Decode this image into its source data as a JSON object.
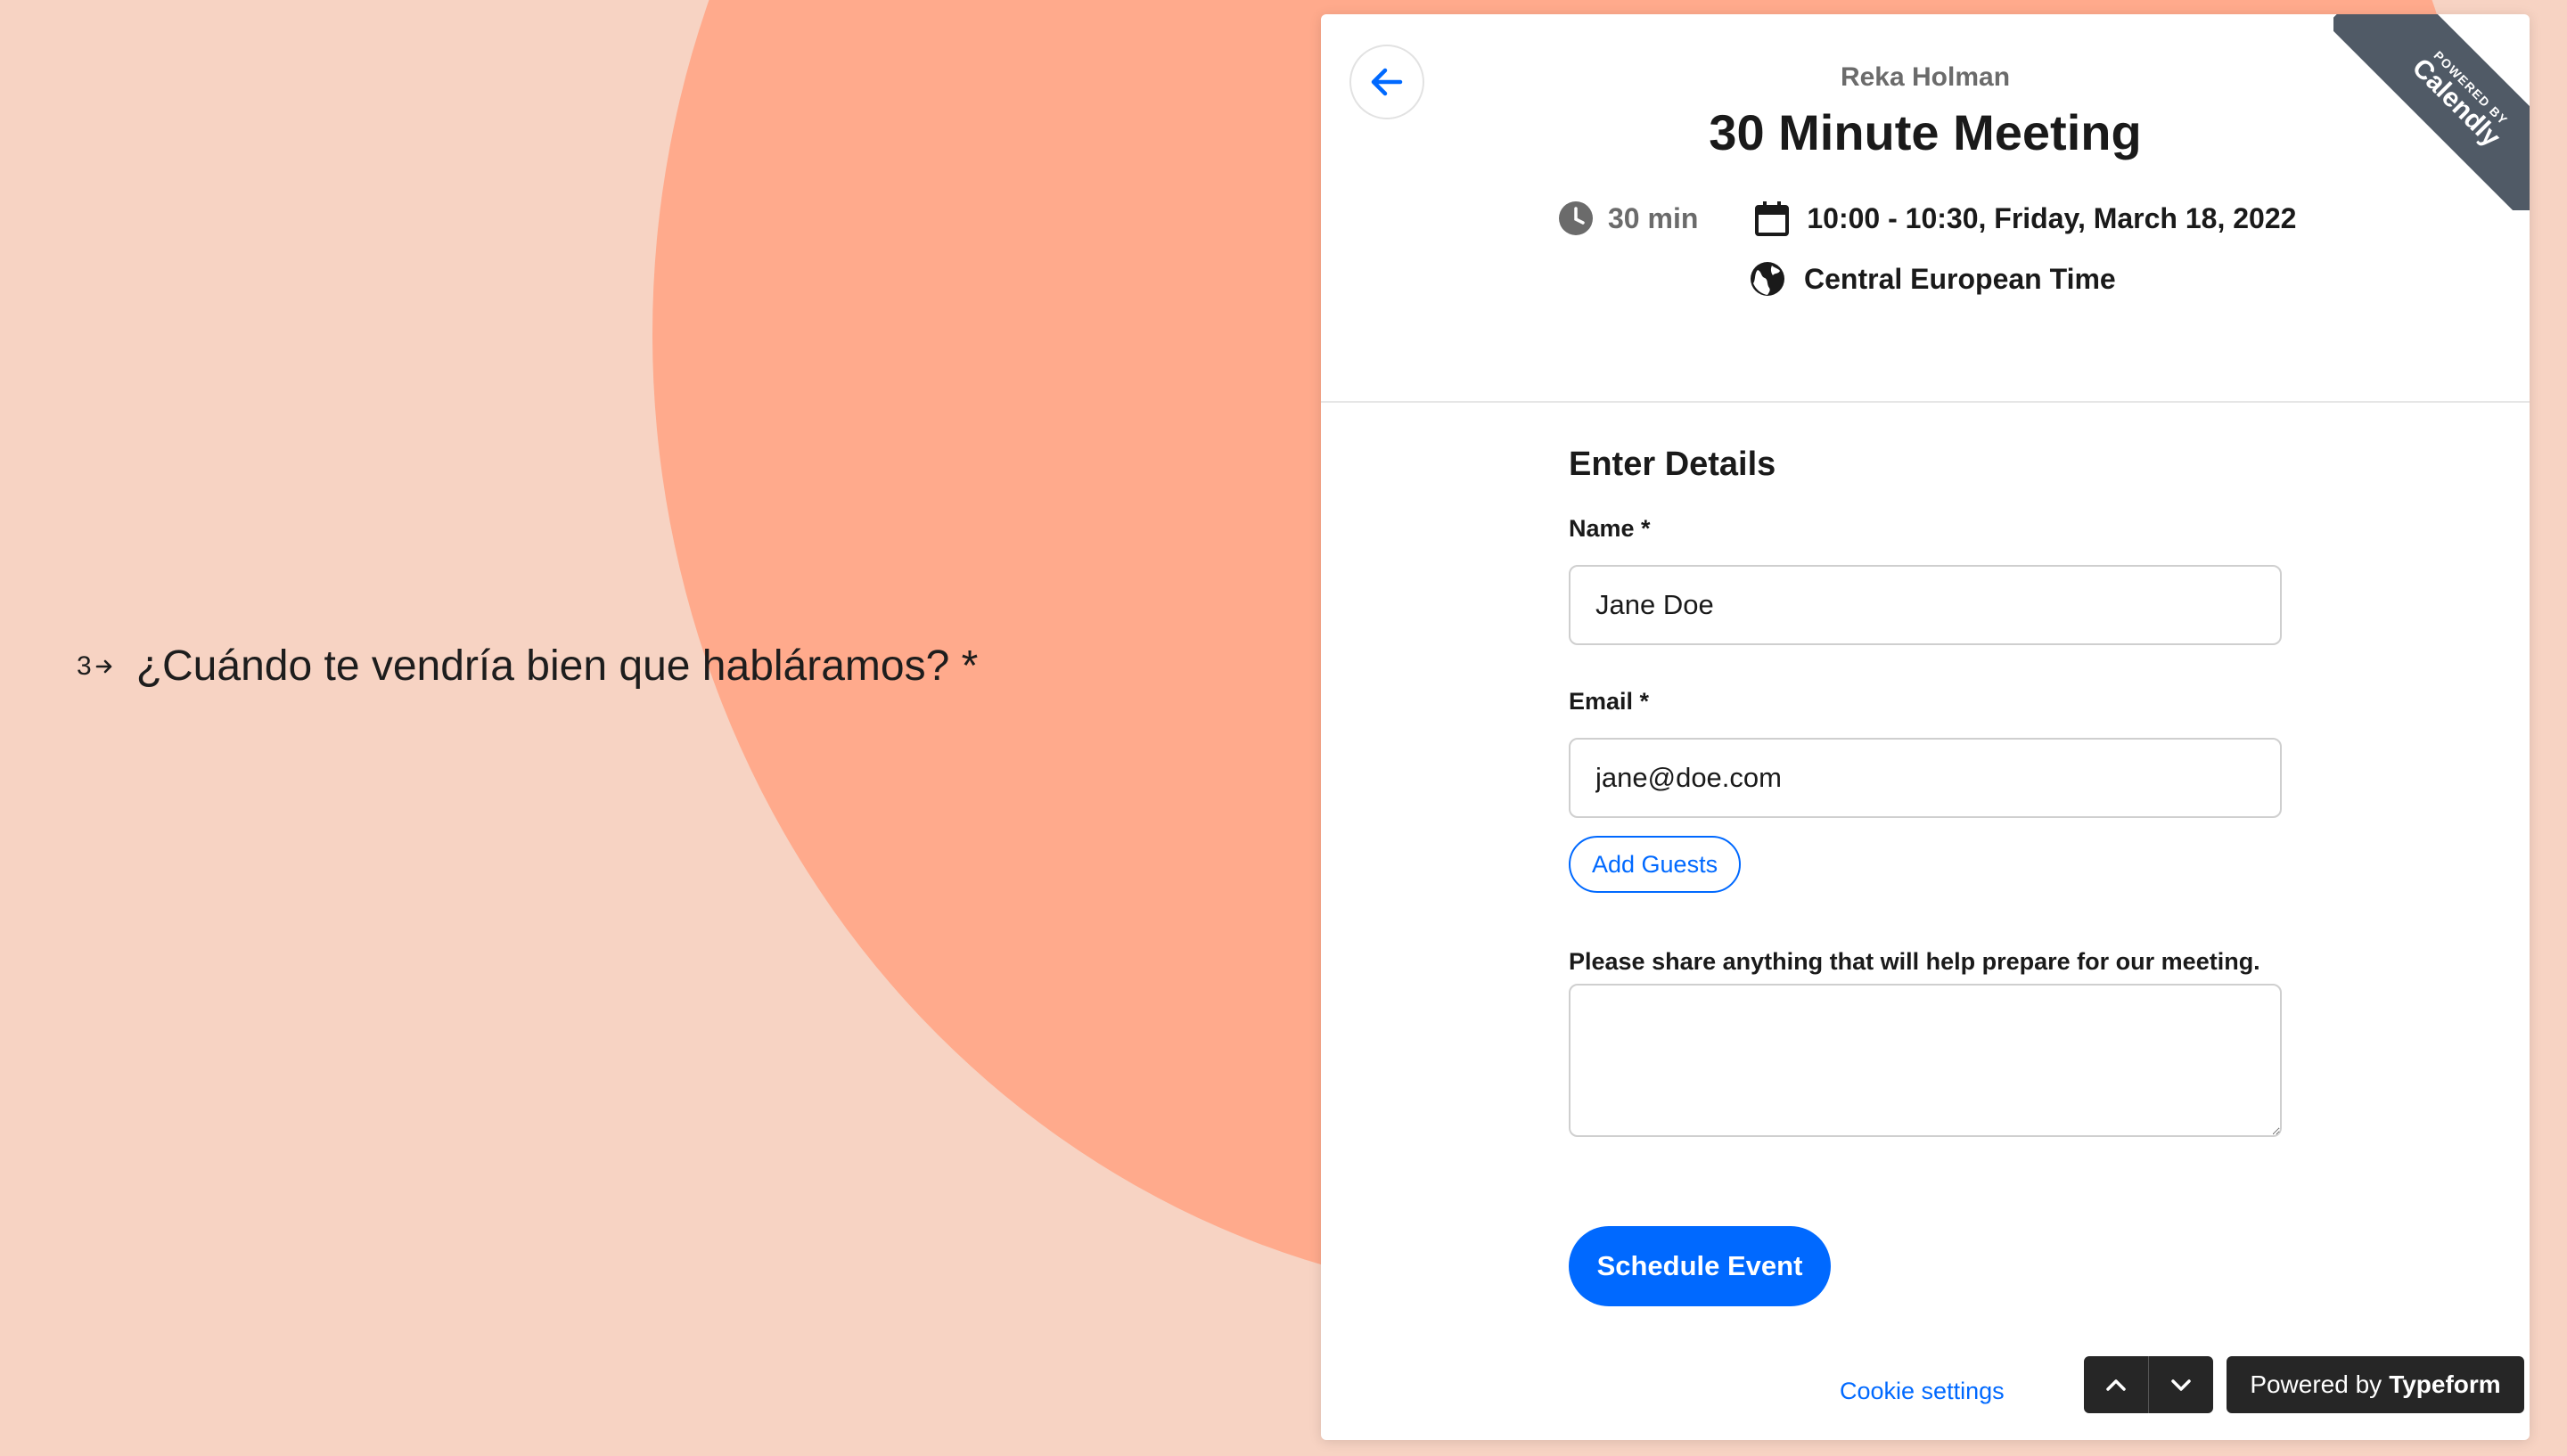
{
  "question": {
    "number": "3",
    "text": "¿Cuándo te vendría bien que habláramos? *"
  },
  "calendly": {
    "ribbon_small": "POWERED BY",
    "ribbon_brand": "Calendly",
    "host_name": "Reka Holman",
    "event_title": "30 Minute Meeting",
    "duration": "30 min",
    "datetime": "10:00 - 10:30, Friday, March 18, 2022",
    "timezone": "Central European Time",
    "form": {
      "heading": "Enter Details",
      "name_label": "Name *",
      "name_value": "Jane Doe",
      "email_label": "Email *",
      "email_value": "jane@doe.com",
      "add_guests": "Add Guests",
      "notes_label": "Please share anything that will help prepare for our meeting.",
      "notes_value": "",
      "submit": "Schedule Event"
    },
    "cookie_settings": "Cookie settings"
  },
  "typeform": {
    "powered_prefix": "Powered by",
    "powered_brand": "Typeform"
  },
  "colors": {
    "background": "#F7D3C3",
    "circle": "#FFAA8C",
    "accent": "#0069ff",
    "dark": "#262626"
  }
}
